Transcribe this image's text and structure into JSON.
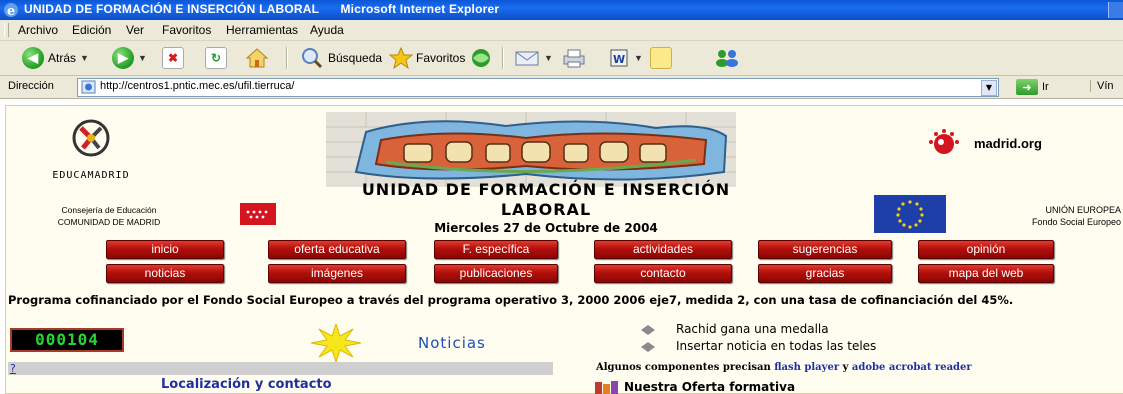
{
  "window": {
    "page_title": "UNIDAD DE FORMACIÓN E INSERCIÓN LABORAL",
    "app_name": "Microsoft Internet Explorer"
  },
  "menu": [
    "Archivo",
    "Edición",
    "Ver",
    "Favoritos",
    "Herramientas",
    "Ayuda"
  ],
  "toolbar": {
    "back_label": "Atrás",
    "search_label": "Búsqueda",
    "favorites_label": "Favoritos"
  },
  "address": {
    "label": "Dirección",
    "url": "http://centros1.pntic.mec.es/ufil.tierruca/",
    "go_label": "Ir",
    "links_label": "Vín"
  },
  "page": {
    "educamadrid": "EDUCAMADRID",
    "madrid_org": "madrid.org",
    "consejeria_line1": "Consejería de Educación",
    "consejeria_line2": "COMUNIDAD DE MADRID",
    "title_line1": "UNIDAD DE FORMACIÓN E INSERCIÓN",
    "title_line2": "LABORAL",
    "date": "Miercoles 27 de Octubre de 2004",
    "union_line1": "UNIÓN EUROPEA",
    "union_line2": "Fondo Social Europeo",
    "nav_row1": [
      "inicio",
      "oferta educativa",
      "F. específica",
      "actividades",
      "sugerencias",
      "opinión"
    ],
    "nav_row2": [
      "noticias",
      "imágenes",
      "publicaciones",
      "contacto",
      "gracias",
      "mapa del web"
    ],
    "programa": "Programa cofinanciado por el Fondo Social Europeo a través del programa operativo 3, 2000 2006 eje7, medida 2, con una tasa de cofinanciación del 45%.",
    "counter": "000104",
    "noticias_heading": "Noticias",
    "news": [
      "Rachid gana una medalla",
      "Insertar noticia en todas las teles"
    ],
    "qmark": "?",
    "localizacion": "Localización y contacto",
    "algunos_text": "Algunos componentes precisan",
    "algunos_link1": "flash player",
    "algunos_and": "y",
    "algunos_link2": "adobe acrobat reader",
    "oferta": "Nuestra Oferta formativa"
  },
  "colors": {
    "titlebar": "#0a58d8",
    "chrome": "#ece9d8",
    "nav_button": "#b3100c",
    "counter_digits": "#26d43a",
    "link_blue": "#1f2fa0"
  }
}
